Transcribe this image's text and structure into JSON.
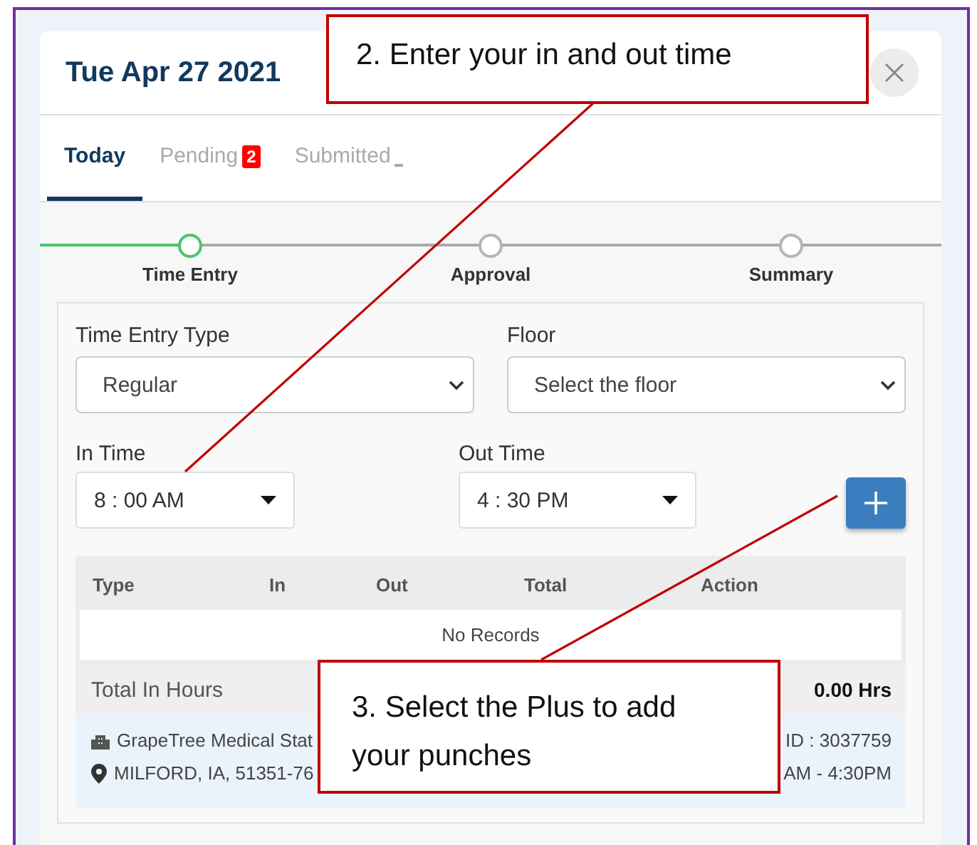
{
  "header": {
    "title": "Tue Apr 27 2021"
  },
  "tabs": [
    {
      "label": "Today",
      "selected": true
    },
    {
      "label": "Pending",
      "selected": false,
      "badge": "2"
    },
    {
      "label": "Submitted",
      "selected": false
    }
  ],
  "steps": [
    {
      "label": "Time Entry",
      "selected": true
    },
    {
      "label": "Approval",
      "selected": false
    },
    {
      "label": "Summary",
      "selected": false
    }
  ],
  "selects": [
    {
      "label": "Time Entry Type",
      "value": "Regular"
    },
    {
      "label": "Floor",
      "placeholder": "Select the floor"
    }
  ],
  "times": [
    {
      "label": "In Time",
      "value": "8 : 00 AM"
    },
    {
      "label": "Out Time",
      "value": "4 : 30 PM"
    }
  ],
  "table": {
    "columns": [
      "Type",
      "In",
      "Out",
      "Total",
      "Action"
    ],
    "empty_message": "No Records"
  },
  "total": {
    "label": "Total In Hours",
    "value": "0.00 Hrs"
  },
  "facility": {
    "name": "GrapeTree Medical Stat",
    "address": "MILFORD, IA, 51351-76",
    "id": "ID : 3037759",
    "hours": "AM - 4:30PM"
  },
  "callouts": [
    {
      "text": "2. Enter your in and out time"
    },
    {
      "text": "3. Select the Plus to add your punches"
    }
  ]
}
